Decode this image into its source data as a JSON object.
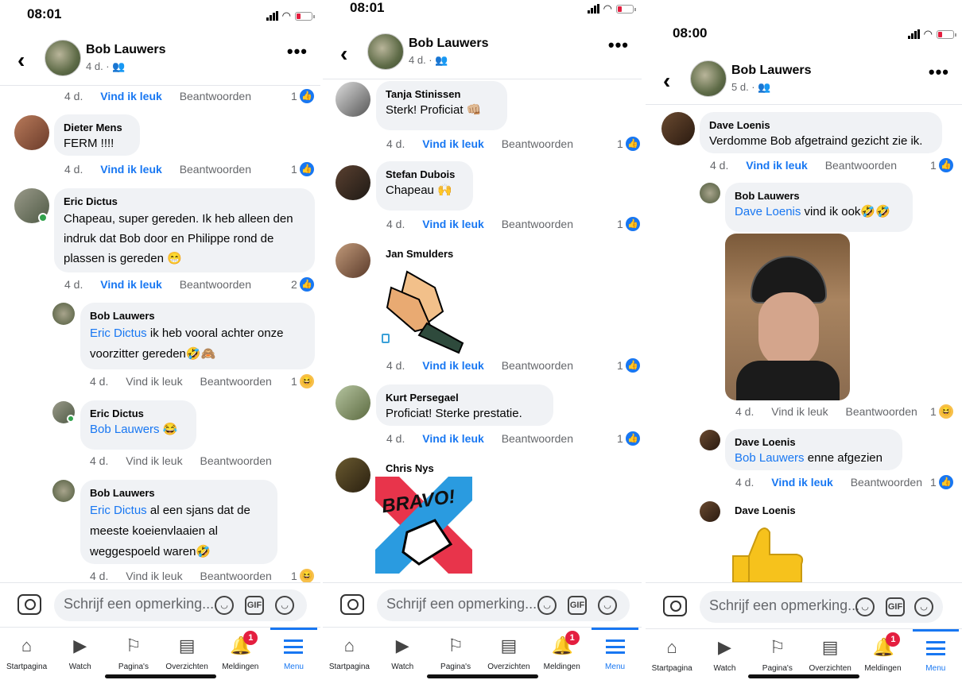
{
  "panels": [
    {
      "time": "08:01",
      "author": "Bob Lauwers",
      "post_meta": "4 d. · 👥",
      "top_actions": {
        "time": "4 d.",
        "like": "Vind ik leuk",
        "reply": "Beantwoorden",
        "count": "1"
      },
      "comments": [
        {
          "name": "Dieter Mens",
          "text": "FERM !!!!",
          "time": "4 d.",
          "like": "Vind ik leuk",
          "reply": "Beantwoorden",
          "count": "1"
        },
        {
          "name": "Eric Dictus",
          "text": "Chapeau, super gereden. Ik heb alleen den indruk dat Bob door en Philippe rond de plassen is gereden 😁",
          "time": "4 d.",
          "like": "Vind ik leuk",
          "reply": "Beantwoorden",
          "count": "2"
        },
        {
          "name": "Bob Lauwers",
          "mention": "Eric Dictus",
          "text": " ik heb vooral achter onze voorzitter gereden🤣🙈",
          "time": "4 d.",
          "like": "Vind ik leuk",
          "reply": "Beantwoorden",
          "count": "1"
        },
        {
          "name": "Eric Dictus",
          "mention": "Bob Lauwers",
          "text": " 😂",
          "time": "4 d.",
          "like": "Vind ik leuk",
          "reply": "Beantwoorden"
        },
        {
          "name": "Bob Lauwers",
          "mention": "Eric Dictus",
          "text": " al een sjans dat de meeste koeienvlaaien al weggespoeld waren🤣",
          "time": "4 d.",
          "like": "Vind ik leuk",
          "reply": "Beantwoorden",
          "count": "1"
        }
      ]
    },
    {
      "time": "08:01",
      "author": "Bob Lauwers",
      "post_meta": "4 d. · 👥",
      "comments": [
        {
          "name": "Tanja Stinissen",
          "text": "Sterk! Proficiat 👊🏼",
          "time": "4 d.",
          "like": "Vind ik leuk",
          "reply": "Beantwoorden",
          "count": "1"
        },
        {
          "name": "Stefan Dubois",
          "text": "Chapeau 🙌",
          "time": "4 d.",
          "like": "Vind ik leuk",
          "reply": "Beantwoorden",
          "count": "1"
        },
        {
          "name": "Jan Smulders",
          "time": "4 d.",
          "like": "Vind ik leuk",
          "reply": "Beantwoorden",
          "count": "1"
        },
        {
          "name": "Kurt Persegael",
          "text": "Proficiat! Sterke prestatie.",
          "time": "4 d.",
          "like": "Vind ik leuk",
          "reply": "Beantwoorden",
          "count": "1"
        },
        {
          "name": "Chris Nys",
          "sticker_text": "BRAVO!"
        }
      ]
    },
    {
      "time": "08:00",
      "author": "Bob Lauwers",
      "post_meta": "5 d. · 👥",
      "comments": [
        {
          "name": "Dave Loenis",
          "text": "Verdomme Bob afgetraind gezicht zie ik.",
          "time": "4 d.",
          "like": "Vind ik leuk",
          "reply": "Beantwoorden",
          "count": "1"
        },
        {
          "name": "Bob Lauwers",
          "mention": "Dave Loenis",
          "text": " vind ik ook🤣🤣",
          "time": "4 d.",
          "like": "Vind ik leuk",
          "reply": "Beantwoorden",
          "count": "1"
        },
        {
          "name": "Dave Loenis",
          "mention": "Bob Lauwers",
          "text": " enne afgezien",
          "time": "4 d.",
          "like": "Vind ik leuk",
          "reply": "Beantwoorden",
          "count": "1"
        },
        {
          "name": "Dave Loenis"
        }
      ]
    }
  ],
  "input_placeholder": "Schrijf een opmerking...",
  "gif_label": "GIF",
  "nav": [
    "Startpagina",
    "Watch",
    "Pagina's",
    "Overzichten",
    "Meldingen",
    "Menu"
  ],
  "notif_badge": "1",
  "icons": {
    "like": "👍",
    "haha": "😆"
  },
  "colors": {
    "accent": "#1877f2",
    "bubble": "#f0f2f5",
    "badge": "#e41e3f"
  }
}
